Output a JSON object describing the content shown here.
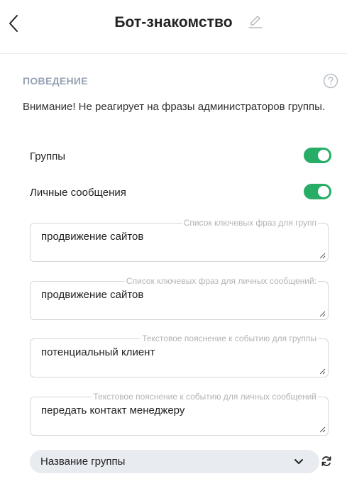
{
  "header": {
    "title": "Бот-знакомство"
  },
  "behavior": {
    "section_title": "ПОВЕДЕНИЕ",
    "warning": "Внимание! Не реагирует на фразы администраторов группы."
  },
  "toggles": [
    {
      "label": "Группы",
      "enabled": true
    },
    {
      "label": "Личные сообщения",
      "enabled": true
    }
  ],
  "fields": [
    {
      "legend": "Список ключевых фраз для групп",
      "value": "продвижение сайтов"
    },
    {
      "legend": "Список ключевых фраз для личных сообщений:",
      "value": "продвижение сайтов"
    },
    {
      "legend": "Текстовое пояснение к событию для группы",
      "value": "потенциальный клиент"
    },
    {
      "legend": "Текстовое пояснение к событию для личных сообщений",
      "value": "передать контакт менеджеру"
    }
  ],
  "group_select": {
    "selected": "Название группы"
  },
  "icons": [
    "back-arrow-icon",
    "pencil-icon",
    "help-icon",
    "resize-handle-icon",
    "chevron-down-icon",
    "refresh-icon"
  ],
  "colors": {
    "toggle_on": "#27ad66",
    "section_title": "#97a2b4",
    "select_bg": "#e8ebf0"
  }
}
